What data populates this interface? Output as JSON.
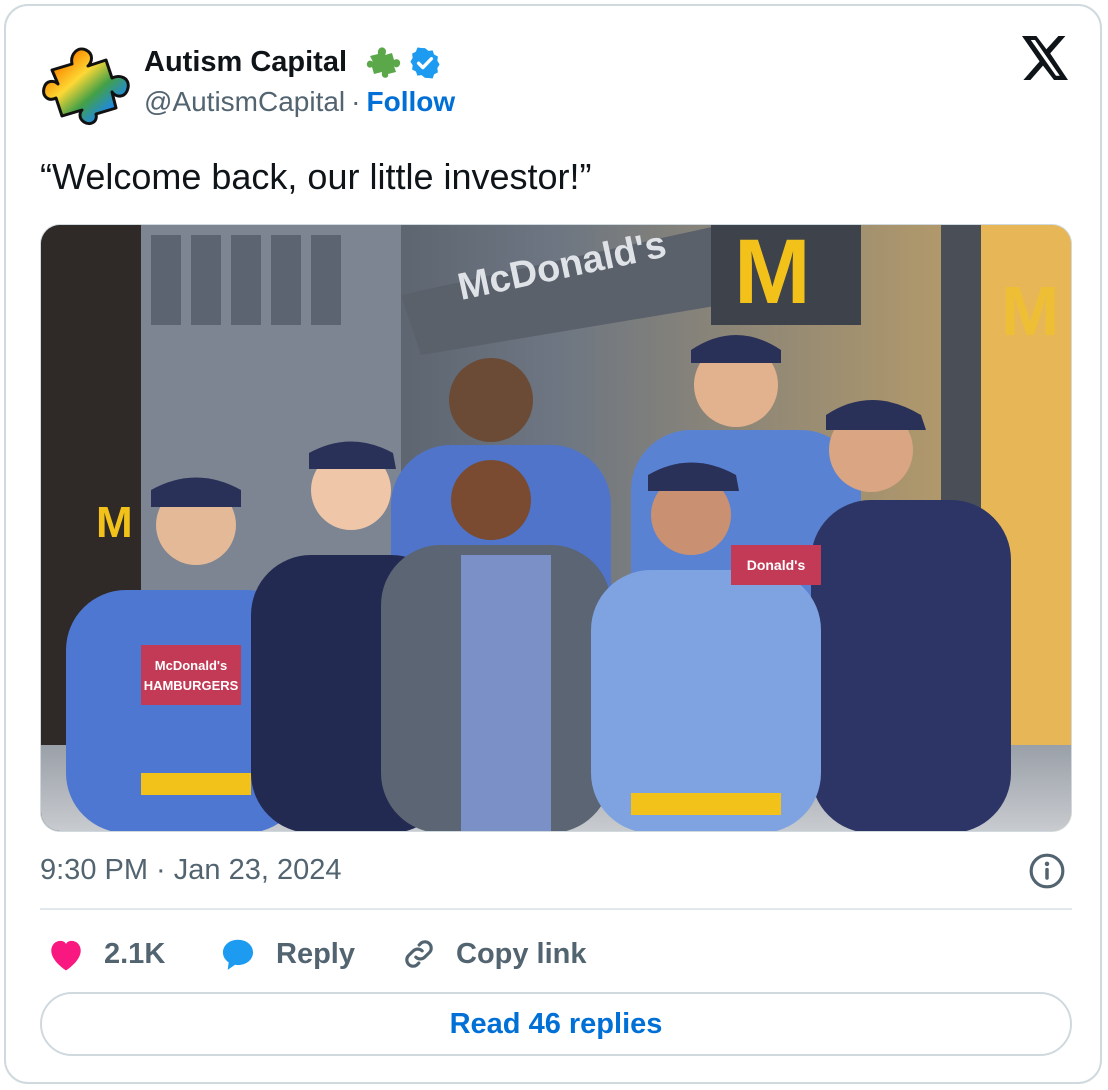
{
  "author": {
    "name": "Autism Capital",
    "handle": "@AutismCapital",
    "separator": "·",
    "follow_label": "Follow"
  },
  "tweet": {
    "text": "“Welcome back, our little investor!”",
    "timestamp": "9:30 PM · Jan 23, 2024"
  },
  "photo": {
    "sign_text": "McDonald's",
    "shirt_text_line1": "McDonald's",
    "shirt_text_line2": "HAMBURGERS",
    "shirt_text_right": "Donald's"
  },
  "actions": {
    "likes": "2.1K",
    "reply_label": "Reply",
    "copy_link_label": "Copy link"
  },
  "read_replies_label": "Read 46 replies",
  "icons": {
    "avatar": "rainbow-puzzle-piece",
    "badge": "green-puzzle-icon",
    "verified": "verified-badge-icon",
    "logo": "x-logo-icon",
    "info": "info-icon",
    "like": "heart-icon",
    "reply": "speech-bubble-icon",
    "copy": "link-icon"
  },
  "colors": {
    "link_blue": "#006fd6",
    "heart_pink": "#f91880",
    "reply_blue": "#1d9bf0",
    "muted_gray": "#536471",
    "verified_blue": "#1d9bf0",
    "puzzle_green": "#5ba84a"
  }
}
